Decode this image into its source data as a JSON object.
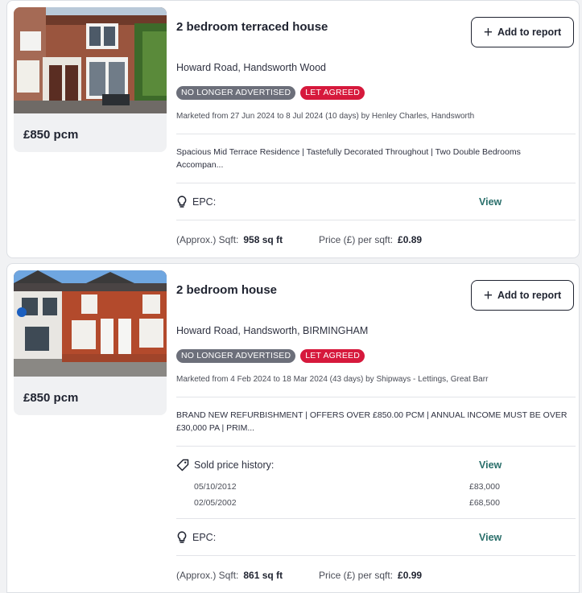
{
  "listings": [
    {
      "title": "2 bedroom terraced house",
      "add_to_report": "Add to report",
      "address": "Howard Road, Handsworth Wood",
      "badges": [
        "NO LONGER ADVERTISED",
        "LET AGREED"
      ],
      "marketed": "Marketed from 27 Jun 2024 to 8 Jul 2024 (10 days) by Henley Charles, Handsworth",
      "description": "Spacious Mid Terrace Residence | Tastefully Decorated Throughout | Two Double Bedrooms Accompan...",
      "price": "£850 pcm",
      "epc_label": "EPC:",
      "epc_link": "View",
      "sqft_label": "(Approx.) Sqft:",
      "sqft_value": "958 sq ft",
      "ppsf_label": "Price (£) per sqft:",
      "ppsf_value": "£0.89"
    },
    {
      "title": "2 bedroom house",
      "add_to_report": "Add to report",
      "address": "Howard Road, Handsworth, BIRMINGHAM",
      "badges": [
        "NO LONGER ADVERTISED",
        "LET AGREED"
      ],
      "marketed": "Marketed from 4 Feb 2024 to 18 Mar 2024 (43 days) by Shipways - Lettings, Great Barr",
      "description": "BRAND NEW REFURBISHMENT | OFFERS OVER £850.00 PCM | ANNUAL INCOME MUST BE OVER £30,000 PA | PRIM...",
      "price": "£850 pcm",
      "sold_history_label": "Sold price history:",
      "sold_history_link": "View",
      "sold_history": [
        {
          "date": "05/10/2012",
          "price": "£83,000"
        },
        {
          "date": "02/05/2002",
          "price": "£68,500"
        }
      ],
      "epc_label": "EPC:",
      "epc_link": "View",
      "sqft_label": "(Approx.) Sqft:",
      "sqft_value": "861 sq ft",
      "ppsf_label": "Price (£) per sqft:",
      "ppsf_value": "£0.99"
    }
  ],
  "colors": {
    "badge_grey": "#6c6f7a",
    "badge_red": "#d6193c",
    "link_teal": "#2a6f6b",
    "text_dark": "#1f2330"
  },
  "icons": {
    "add": "plus-icon",
    "epc": "lightbulb-icon",
    "sold_history": "price-tag-icon"
  }
}
